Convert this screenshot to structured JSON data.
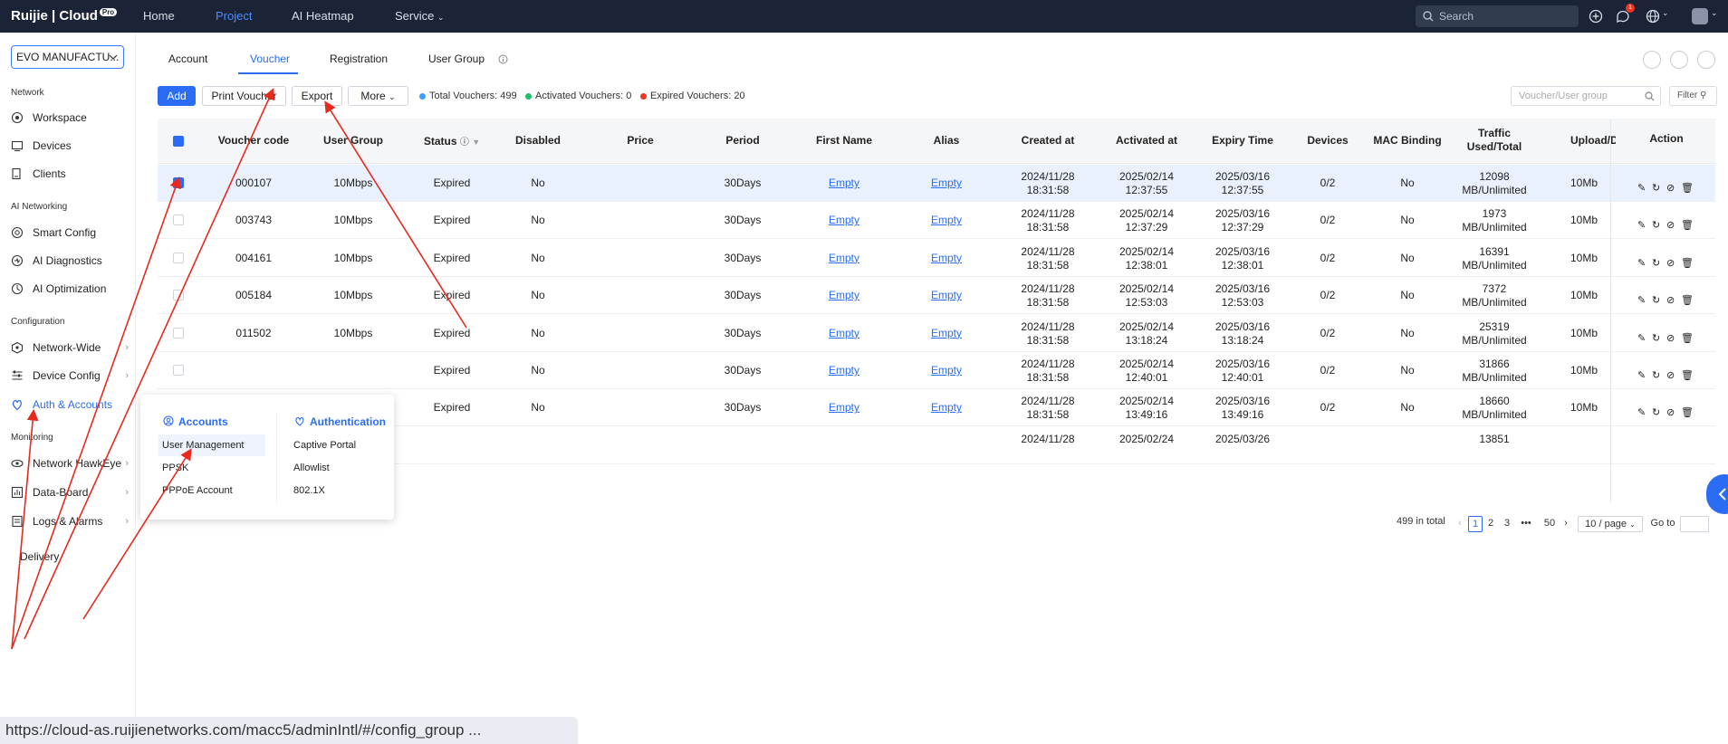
{
  "brand": {
    "logo_text": "Ruijie | Cloud",
    "logo_badge": "Pro"
  },
  "topnav": {
    "items": [
      "Home",
      "Project",
      "AI Heatmap",
      "Service"
    ],
    "active": "Project"
  },
  "search": {
    "placeholder": "Search"
  },
  "notification_count": "1",
  "sidebar": {
    "project_select": "EVO MANUFACTU...",
    "groups": [
      "Network",
      "AI Networking",
      "Configuration",
      "Monitoring"
    ],
    "items": [
      {
        "label": "Workspace",
        "icon": "workspace-icon"
      },
      {
        "label": "Devices",
        "icon": "devices-icon"
      },
      {
        "label": "Clients",
        "icon": "clients-icon"
      },
      {
        "label": "Smart Config",
        "icon": "smart-config-icon"
      },
      {
        "label": "AI Diagnostics",
        "icon": "ai-diagnostics-icon"
      },
      {
        "label": "AI Optimization",
        "icon": "ai-optimization-icon"
      },
      {
        "label": "Network-Wide",
        "icon": "network-wide-icon"
      },
      {
        "label": "Device Config",
        "icon": "device-config-icon"
      },
      {
        "label": "Auth & Accounts",
        "icon": "auth-accounts-icon"
      },
      {
        "label": "Network HawkEye",
        "icon": "hawkeye-icon"
      },
      {
        "label": "Data-Board",
        "icon": "data-board-icon"
      },
      {
        "label": "Logs & Alarms",
        "icon": "logs-alarms-icon"
      },
      {
        "label": "Delivery",
        "icon": ""
      }
    ]
  },
  "tabs": [
    "Account",
    "Voucher",
    "Registration",
    "User Group"
  ],
  "active_tab": "Voucher",
  "toolbar": {
    "add": "Add",
    "print": "Print Voucher",
    "export": "Export",
    "more": "More",
    "total": "Total Vouchers: 499",
    "activated": "Activated Vouchers: 0",
    "expired": "Expired Vouchers: 20",
    "filter_placeholder": "Voucher/User group",
    "filter": "Filter"
  },
  "colors": {
    "accent": "#2a6cf4",
    "topbar": "#1b2436",
    "total_dot": "#3aa0ff",
    "activated_dot": "#20c06a",
    "expired_dot": "#f5341f",
    "annotation": "#e62a1e"
  },
  "table": {
    "headers": [
      "Voucher code",
      "User Group",
      "Status",
      "Disabled",
      "Price",
      "Period",
      "First Name",
      "Alias",
      "Created at",
      "Activated at",
      "Expiry Time",
      "Devices",
      "MAC Binding",
      "Traffic Used/Total",
      "Upload/D",
      "Action"
    ],
    "rows": [
      {
        "code": "000107",
        "group": "10Mbps",
        "status": "Expired",
        "disabled": "No",
        "period": "30Days",
        "first_name": "Empty",
        "alias": "Empty",
        "created": [
          "2024/11/28",
          "18:31:58"
        ],
        "activated": [
          "2025/02/14",
          "12:37:55"
        ],
        "expiry": [
          "2025/03/16",
          "12:37:55"
        ],
        "devices": "0/2",
        "mac": "No",
        "traffic": [
          "12098",
          "MB/Unlimited"
        ],
        "upload": "10Mb",
        "selected": true
      },
      {
        "code": "003743",
        "group": "10Mbps",
        "status": "Expired",
        "disabled": "No",
        "period": "30Days",
        "first_name": "Empty",
        "alias": "Empty",
        "created": [
          "2024/11/28",
          "18:31:58"
        ],
        "activated": [
          "2025/02/14",
          "12:37:29"
        ],
        "expiry": [
          "2025/03/16",
          "12:37:29"
        ],
        "devices": "0/2",
        "mac": "No",
        "traffic": [
          "1973",
          "MB/Unlimited"
        ],
        "upload": "10Mb",
        "selected": false
      },
      {
        "code": "004161",
        "group": "10Mbps",
        "status": "Expired",
        "disabled": "No",
        "period": "30Days",
        "first_name": "Empty",
        "alias": "Empty",
        "created": [
          "2024/11/28",
          "18:31:58"
        ],
        "activated": [
          "2025/02/14",
          "12:38:01"
        ],
        "expiry": [
          "2025/03/16",
          "12:38:01"
        ],
        "devices": "0/2",
        "mac": "No",
        "traffic": [
          "16391",
          "MB/Unlimited"
        ],
        "upload": "10Mb",
        "selected": false
      },
      {
        "code": "005184",
        "group": "10Mbps",
        "status": "Expired",
        "disabled": "No",
        "period": "30Days",
        "first_name": "Empty",
        "alias": "Empty",
        "created": [
          "2024/11/28",
          "18:31:58"
        ],
        "activated": [
          "2025/02/14",
          "12:53:03"
        ],
        "expiry": [
          "2025/03/16",
          "12:53:03"
        ],
        "devices": "0/2",
        "mac": "No",
        "traffic": [
          "7372",
          "MB/Unlimited"
        ],
        "upload": "10Mb",
        "selected": false
      },
      {
        "code": "011502",
        "group": "10Mbps",
        "status": "Expired",
        "disabled": "No",
        "period": "30Days",
        "first_name": "Empty",
        "alias": "Empty",
        "created": [
          "2024/11/28",
          "18:31:58"
        ],
        "activated": [
          "2025/02/14",
          "13:18:24"
        ],
        "expiry": [
          "2025/03/16",
          "13:18:24"
        ],
        "devices": "0/2",
        "mac": "No",
        "traffic": [
          "25319",
          "MB/Unlimited"
        ],
        "upload": "10Mb",
        "selected": false
      },
      {
        "code": "",
        "group": "",
        "status": "Expired",
        "disabled": "No",
        "period": "30Days",
        "first_name": "Empty",
        "alias": "Empty",
        "created": [
          "2024/11/28",
          "18:31:58"
        ],
        "activated": [
          "2025/02/14",
          "12:40:01"
        ],
        "expiry": [
          "2025/03/16",
          "12:40:01"
        ],
        "devices": "0/2",
        "mac": "No",
        "traffic": [
          "31866",
          "MB/Unlimited"
        ],
        "upload": "10Mb",
        "selected": false
      },
      {
        "code": "",
        "group": "",
        "status": "Expired",
        "disabled": "No",
        "period": "30Days",
        "first_name": "Empty",
        "alias": "Empty",
        "created": [
          "2024/11/28",
          "18:31:58"
        ],
        "activated": [
          "2025/02/14",
          "13:49:16"
        ],
        "expiry": [
          "2025/03/16",
          "13:49:16"
        ],
        "devices": "0/2",
        "mac": "No",
        "traffic": [
          "18660",
          "MB/Unlimited"
        ],
        "upload": "10Mb",
        "selected": false
      },
      {
        "code": "",
        "group": "",
        "status": "",
        "disabled": "",
        "period": "",
        "first_name": "",
        "alias": "",
        "created": [
          "2024/11/28",
          ""
        ],
        "activated": [
          "2025/02/24",
          ""
        ],
        "expiry": [
          "2025/03/26",
          ""
        ],
        "devices": "",
        "mac": "",
        "traffic": [
          "13851",
          ""
        ],
        "upload": "",
        "selected": false
      }
    ]
  },
  "pagination": {
    "total": "499 in total",
    "pages": [
      "1",
      "2",
      "3",
      "•••",
      "50"
    ],
    "current": "1",
    "page_size": "10 / page",
    "goto": "Go to"
  },
  "popup": {
    "accounts_title": "Accounts",
    "accounts_items": [
      "User Management",
      "PPSK",
      "PPPoE Account"
    ],
    "auth_title": "Authentication",
    "auth_items": [
      "Captive Portal",
      "Allowlist",
      "802.1X"
    ]
  },
  "statusbar": {
    "url": "https://cloud-as.ruijienetworks.com/macc5/adminIntl/#/config_group ..."
  }
}
